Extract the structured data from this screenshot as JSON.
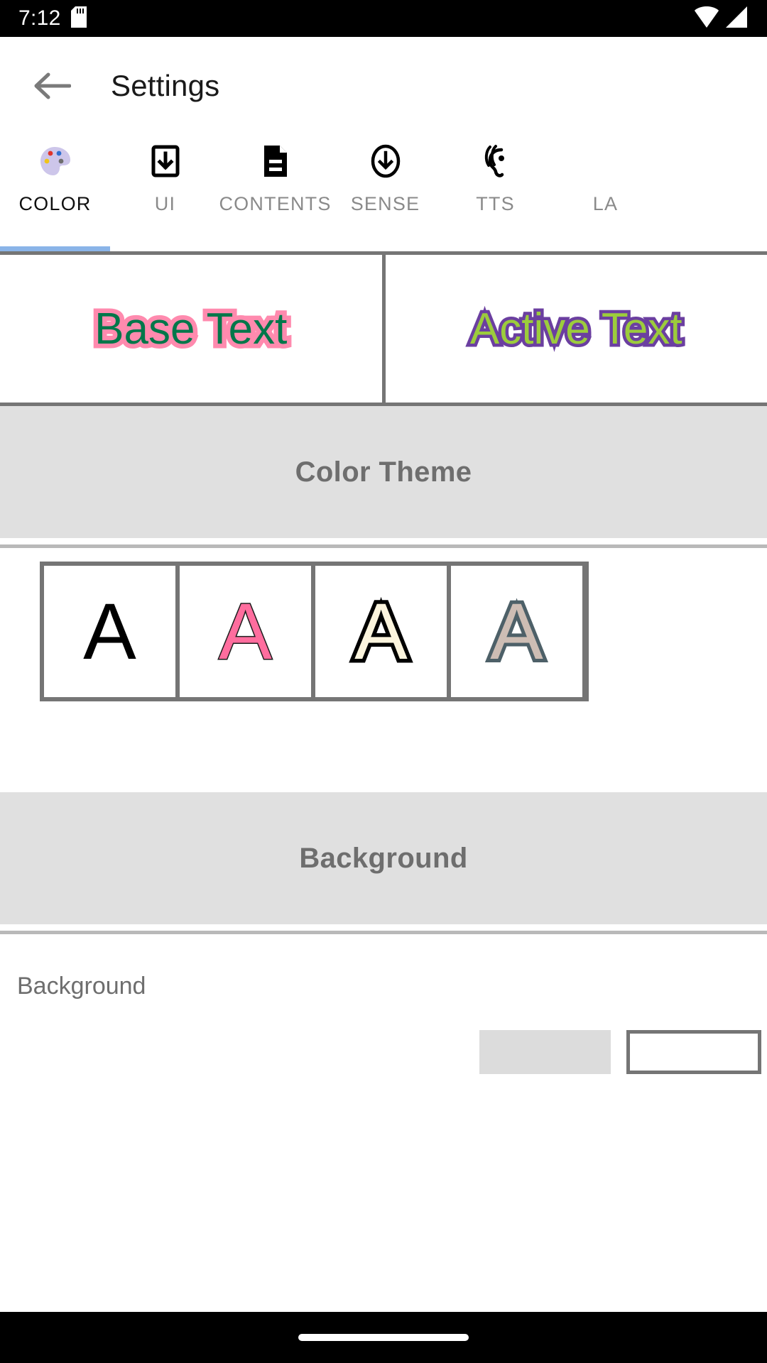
{
  "status_bar": {
    "clock": "7:12",
    "icons": [
      "sd-card-icon",
      "wifi-icon",
      "cell-signal-icon"
    ],
    "background_color": "#000000",
    "foreground_color": "#ffffff"
  },
  "app_bar": {
    "back_label": "back-arrow",
    "title": "Settings"
  },
  "tabs": {
    "active_index": 0,
    "indicator_color": "#8ab4e8",
    "items": [
      {
        "label": "COLOR",
        "icon": "palette-icon"
      },
      {
        "label": "UI",
        "icon": "phone-download-icon"
      },
      {
        "label": "CONTENTS",
        "icon": "document-icon"
      },
      {
        "label": "SENSE",
        "icon": "circle-download-icon"
      },
      {
        "label": "TTS",
        "icon": "ear-hearing-icon"
      },
      {
        "label": "LA",
        "icon": "language-icon"
      }
    ]
  },
  "preview": {
    "frame_color": "#757575",
    "boxes": [
      {
        "name": "base-text-preview",
        "text": "Base Text",
        "fill_color": "#00774a",
        "stroke_color": "#ff8aae"
      },
      {
        "name": "active-text-preview",
        "text": "Active Text",
        "fill_color": "#9ccc3c",
        "stroke_color": "#6b3fa0"
      }
    ]
  },
  "sections": [
    {
      "id": "color-theme",
      "title": "Color Theme",
      "band_color": "#e0e0e0",
      "title_color": "#6e6e6e"
    },
    {
      "id": "background",
      "title": "Background",
      "band_color": "#e0e0e0",
      "title_color": "#6e6e6e"
    }
  ],
  "color_theme": {
    "swatch_letter": "A",
    "swatches": [
      {
        "name": "theme-swatch-black",
        "fill_color": "#000000",
        "stroke_color": "#000000"
      },
      {
        "name": "theme-swatch-pink",
        "fill_color": "#ff6d9e",
        "stroke_color": "#1c1c1c"
      },
      {
        "name": "theme-swatch-cream",
        "fill_color": "#fbf4dd",
        "stroke_color": "#000000"
      },
      {
        "name": "theme-swatch-taupe",
        "fill_color": "#cdbdb4",
        "stroke_color": "#4d6068"
      }
    ]
  },
  "background_section": {
    "row_label": "Background",
    "chip_color": "#dcdcdc",
    "field_border_color": "#757575"
  },
  "nav_bar": {
    "gesture_pill": "home-gesture-pill"
  }
}
